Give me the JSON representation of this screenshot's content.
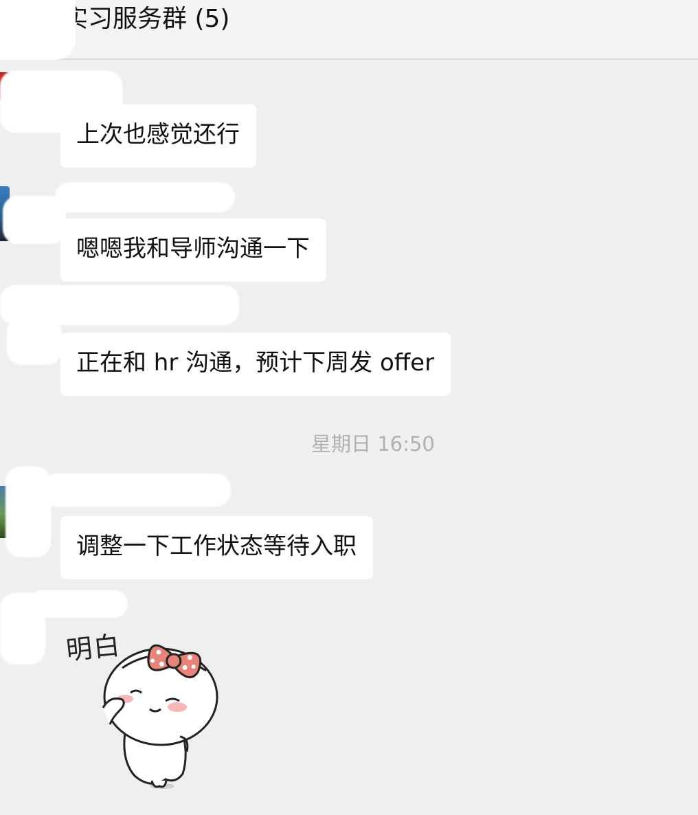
{
  "header": {
    "title": "实习服务群 (5)"
  },
  "messages": [
    {
      "type": "text",
      "text": "上次也感觉还行"
    },
    {
      "type": "text",
      "text": "嗯嗯我和导师沟通一下"
    },
    {
      "type": "text",
      "text": "正在和 hr 沟通，预计下周发 offer"
    },
    {
      "type": "time",
      "text": "星期日 16:50"
    },
    {
      "type": "text",
      "text": "调整一下工作状态等待入职"
    },
    {
      "type": "sticker",
      "text": "明白",
      "icon": "girl-bow-salute-sticker"
    }
  ],
  "colors": {
    "background": "#efefef",
    "bubble": "#ffffff",
    "timestamp": "#b1b1b1",
    "bow": "#e8837a"
  }
}
